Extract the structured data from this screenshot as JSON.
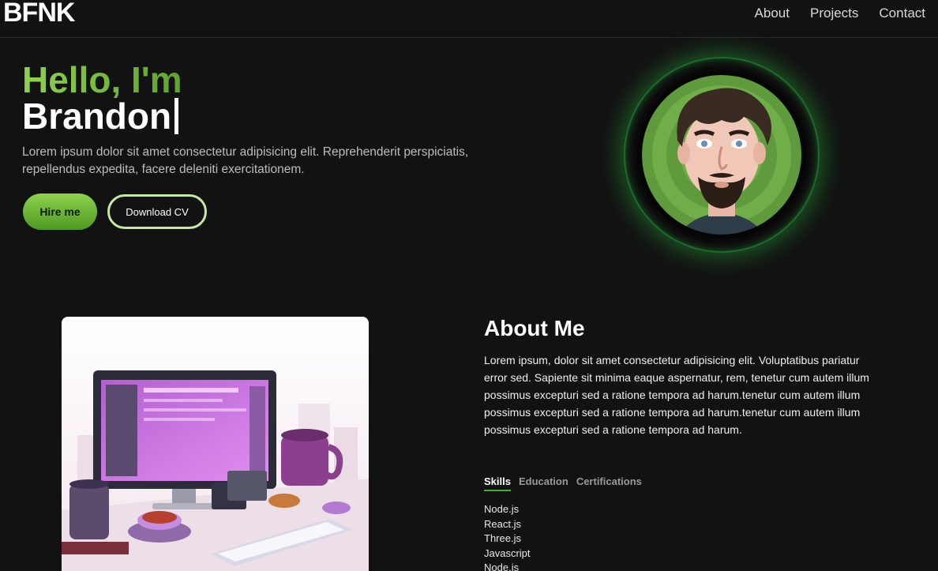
{
  "nav": {
    "logo": "BFNK",
    "links": [
      "About",
      "Projects",
      "Contact"
    ]
  },
  "hero": {
    "greeting": "Hello, I'm",
    "name": "Brandon",
    "description": "Lorem ipsum dolor sit amet consectetur adipisicing elit. Reprehenderit perspiciatis, repellendus expedita, facere deleniti exercitationem.",
    "hire_label": "Hire me",
    "cv_label": "Download CV"
  },
  "about": {
    "title": "About Me",
    "text": "Lorem ipsum, dolor sit amet consectetur adipisicing elit. Voluptatibus pariatur error sed. Sapiente sit minima eaque aspernatur, rem, tenetur cum autem illum possimus excepturi sed a ratione tempora ad harum.tenetur cum autem illum possimus excepturi sed a ratione tempora ad harum.tenetur cum autem illum possimus excepturi sed a ratione tempora ad harum.",
    "tabs": [
      "Skills",
      "Education",
      "Certifications"
    ],
    "active_tab": "Skills",
    "skills": [
      "Node.js",
      "React.js",
      "Three.js",
      "Javascript",
      "Node.js"
    ]
  },
  "colors": {
    "accent_green": "#8fd14f",
    "background": "#121212"
  },
  "icons": {
    "avatar": "cartoon-avatar-illustration",
    "about_image": "desk-computer-illustration"
  }
}
